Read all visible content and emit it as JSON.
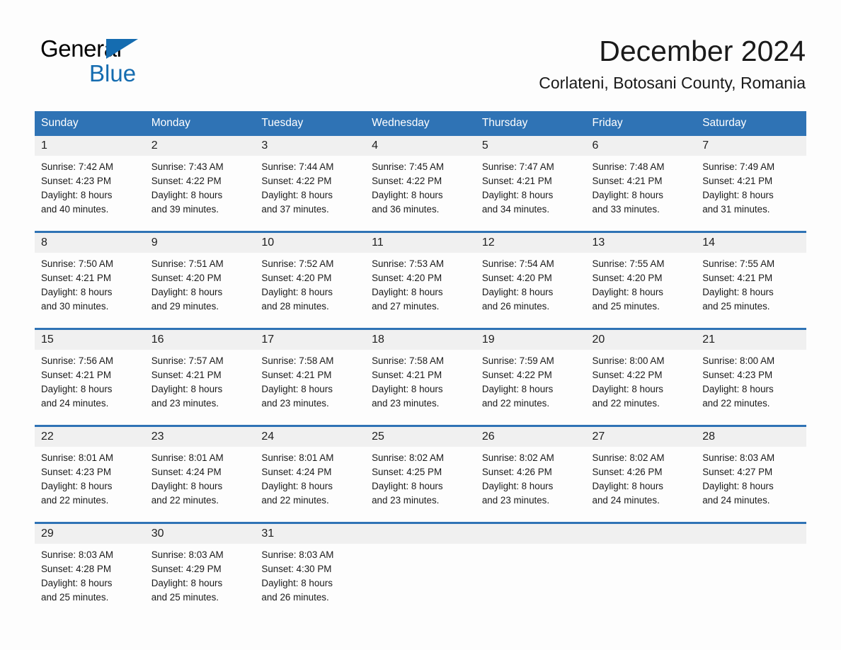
{
  "brand": {
    "name_part1": "General",
    "name_part2": "Blue",
    "accent_color": "#156cb0"
  },
  "header": {
    "title": "December 2024",
    "subtitle": "Corlateni, Botosani County, Romania",
    "header_bar_color": "#2f73b5"
  },
  "weekday_headers": [
    "Sunday",
    "Monday",
    "Tuesday",
    "Wednesday",
    "Thursday",
    "Friday",
    "Saturday"
  ],
  "labels": {
    "sunrise_prefix": "Sunrise:",
    "sunset_prefix": "Sunset:",
    "daylight_prefix": "Daylight:"
  },
  "weeks": [
    [
      {
        "day": "1",
        "sunrise": "Sunrise: 7:42 AM",
        "sunset": "Sunset: 4:23 PM",
        "daylight1": "Daylight: 8 hours",
        "daylight2": "and 40 minutes."
      },
      {
        "day": "2",
        "sunrise": "Sunrise: 7:43 AM",
        "sunset": "Sunset: 4:22 PM",
        "daylight1": "Daylight: 8 hours",
        "daylight2": "and 39 minutes."
      },
      {
        "day": "3",
        "sunrise": "Sunrise: 7:44 AM",
        "sunset": "Sunset: 4:22 PM",
        "daylight1": "Daylight: 8 hours",
        "daylight2": "and 37 minutes."
      },
      {
        "day": "4",
        "sunrise": "Sunrise: 7:45 AM",
        "sunset": "Sunset: 4:22 PM",
        "daylight1": "Daylight: 8 hours",
        "daylight2": "and 36 minutes."
      },
      {
        "day": "5",
        "sunrise": "Sunrise: 7:47 AM",
        "sunset": "Sunset: 4:21 PM",
        "daylight1": "Daylight: 8 hours",
        "daylight2": "and 34 minutes."
      },
      {
        "day": "6",
        "sunrise": "Sunrise: 7:48 AM",
        "sunset": "Sunset: 4:21 PM",
        "daylight1": "Daylight: 8 hours",
        "daylight2": "and 33 minutes."
      },
      {
        "day": "7",
        "sunrise": "Sunrise: 7:49 AM",
        "sunset": "Sunset: 4:21 PM",
        "daylight1": "Daylight: 8 hours",
        "daylight2": "and 31 minutes."
      }
    ],
    [
      {
        "day": "8",
        "sunrise": "Sunrise: 7:50 AM",
        "sunset": "Sunset: 4:21 PM",
        "daylight1": "Daylight: 8 hours",
        "daylight2": "and 30 minutes."
      },
      {
        "day": "9",
        "sunrise": "Sunrise: 7:51 AM",
        "sunset": "Sunset: 4:20 PM",
        "daylight1": "Daylight: 8 hours",
        "daylight2": "and 29 minutes."
      },
      {
        "day": "10",
        "sunrise": "Sunrise: 7:52 AM",
        "sunset": "Sunset: 4:20 PM",
        "daylight1": "Daylight: 8 hours",
        "daylight2": "and 28 minutes."
      },
      {
        "day": "11",
        "sunrise": "Sunrise: 7:53 AM",
        "sunset": "Sunset: 4:20 PM",
        "daylight1": "Daylight: 8 hours",
        "daylight2": "and 27 minutes."
      },
      {
        "day": "12",
        "sunrise": "Sunrise: 7:54 AM",
        "sunset": "Sunset: 4:20 PM",
        "daylight1": "Daylight: 8 hours",
        "daylight2": "and 26 minutes."
      },
      {
        "day": "13",
        "sunrise": "Sunrise: 7:55 AM",
        "sunset": "Sunset: 4:20 PM",
        "daylight1": "Daylight: 8 hours",
        "daylight2": "and 25 minutes."
      },
      {
        "day": "14",
        "sunrise": "Sunrise: 7:55 AM",
        "sunset": "Sunset: 4:21 PM",
        "daylight1": "Daylight: 8 hours",
        "daylight2": "and 25 minutes."
      }
    ],
    [
      {
        "day": "15",
        "sunrise": "Sunrise: 7:56 AM",
        "sunset": "Sunset: 4:21 PM",
        "daylight1": "Daylight: 8 hours",
        "daylight2": "and 24 minutes."
      },
      {
        "day": "16",
        "sunrise": "Sunrise: 7:57 AM",
        "sunset": "Sunset: 4:21 PM",
        "daylight1": "Daylight: 8 hours",
        "daylight2": "and 23 minutes."
      },
      {
        "day": "17",
        "sunrise": "Sunrise: 7:58 AM",
        "sunset": "Sunset: 4:21 PM",
        "daylight1": "Daylight: 8 hours",
        "daylight2": "and 23 minutes."
      },
      {
        "day": "18",
        "sunrise": "Sunrise: 7:58 AM",
        "sunset": "Sunset: 4:21 PM",
        "daylight1": "Daylight: 8 hours",
        "daylight2": "and 23 minutes."
      },
      {
        "day": "19",
        "sunrise": "Sunrise: 7:59 AM",
        "sunset": "Sunset: 4:22 PM",
        "daylight1": "Daylight: 8 hours",
        "daylight2": "and 22 minutes."
      },
      {
        "day": "20",
        "sunrise": "Sunrise: 8:00 AM",
        "sunset": "Sunset: 4:22 PM",
        "daylight1": "Daylight: 8 hours",
        "daylight2": "and 22 minutes."
      },
      {
        "day": "21",
        "sunrise": "Sunrise: 8:00 AM",
        "sunset": "Sunset: 4:23 PM",
        "daylight1": "Daylight: 8 hours",
        "daylight2": "and 22 minutes."
      }
    ],
    [
      {
        "day": "22",
        "sunrise": "Sunrise: 8:01 AM",
        "sunset": "Sunset: 4:23 PM",
        "daylight1": "Daylight: 8 hours",
        "daylight2": "and 22 minutes."
      },
      {
        "day": "23",
        "sunrise": "Sunrise: 8:01 AM",
        "sunset": "Sunset: 4:24 PM",
        "daylight1": "Daylight: 8 hours",
        "daylight2": "and 22 minutes."
      },
      {
        "day": "24",
        "sunrise": "Sunrise: 8:01 AM",
        "sunset": "Sunset: 4:24 PM",
        "daylight1": "Daylight: 8 hours",
        "daylight2": "and 22 minutes."
      },
      {
        "day": "25",
        "sunrise": "Sunrise: 8:02 AM",
        "sunset": "Sunset: 4:25 PM",
        "daylight1": "Daylight: 8 hours",
        "daylight2": "and 23 minutes."
      },
      {
        "day": "26",
        "sunrise": "Sunrise: 8:02 AM",
        "sunset": "Sunset: 4:26 PM",
        "daylight1": "Daylight: 8 hours",
        "daylight2": "and 23 minutes."
      },
      {
        "day": "27",
        "sunrise": "Sunrise: 8:02 AM",
        "sunset": "Sunset: 4:26 PM",
        "daylight1": "Daylight: 8 hours",
        "daylight2": "and 24 minutes."
      },
      {
        "day": "28",
        "sunrise": "Sunrise: 8:03 AM",
        "sunset": "Sunset: 4:27 PM",
        "daylight1": "Daylight: 8 hours",
        "daylight2": "and 24 minutes."
      }
    ],
    [
      {
        "day": "29",
        "sunrise": "Sunrise: 8:03 AM",
        "sunset": "Sunset: 4:28 PM",
        "daylight1": "Daylight: 8 hours",
        "daylight2": "and 25 minutes."
      },
      {
        "day": "30",
        "sunrise": "Sunrise: 8:03 AM",
        "sunset": "Sunset: 4:29 PM",
        "daylight1": "Daylight: 8 hours",
        "daylight2": "and 25 minutes."
      },
      {
        "day": "31",
        "sunrise": "Sunrise: 8:03 AM",
        "sunset": "Sunset: 4:30 PM",
        "daylight1": "Daylight: 8 hours",
        "daylight2": "and 26 minutes."
      },
      {
        "day": "",
        "sunrise": "",
        "sunset": "",
        "daylight1": "",
        "daylight2": ""
      },
      {
        "day": "",
        "sunrise": "",
        "sunset": "",
        "daylight1": "",
        "daylight2": ""
      },
      {
        "day": "",
        "sunrise": "",
        "sunset": "",
        "daylight1": "",
        "daylight2": ""
      },
      {
        "day": "",
        "sunrise": "",
        "sunset": "",
        "daylight1": "",
        "daylight2": ""
      }
    ]
  ]
}
